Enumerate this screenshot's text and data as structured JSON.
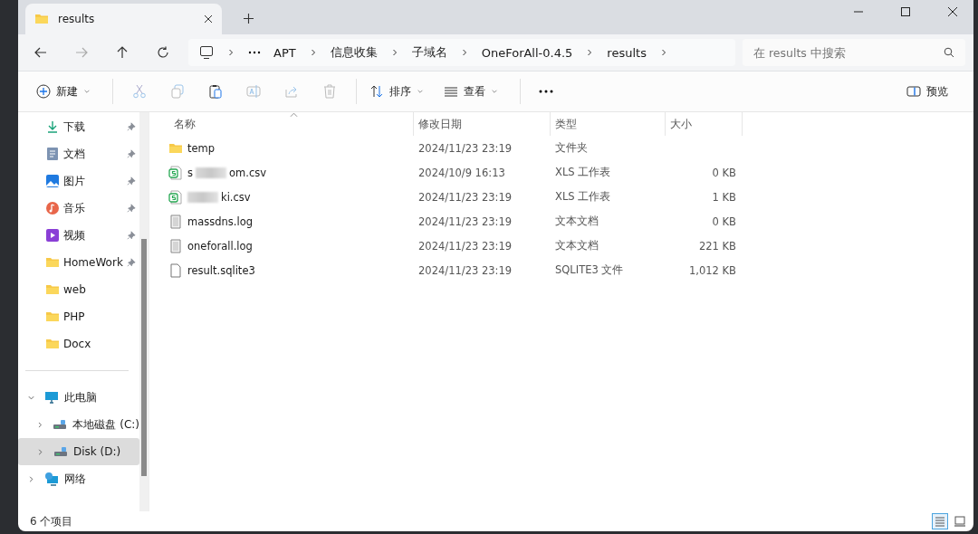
{
  "tab": {
    "title": "results",
    "selected": true
  },
  "breadcrumb": [
    "APT",
    "信息收集",
    "子域名",
    "OneForAll-0.4.5",
    "results"
  ],
  "search": {
    "placeholder": "在 results 中搜索"
  },
  "toolbar": {
    "new_label": "新建",
    "sort_label": "排序",
    "view_label": "查看",
    "preview_label": "预览"
  },
  "sidebar": {
    "items": [
      {
        "label": "下载",
        "kind": "download",
        "pinned": true,
        "selected": false
      },
      {
        "label": "文档",
        "kind": "document",
        "pinned": true,
        "selected": false
      },
      {
        "label": "图片",
        "kind": "pictures",
        "pinned": true,
        "selected": false
      },
      {
        "label": "音乐",
        "kind": "music",
        "pinned": true,
        "selected": false
      },
      {
        "label": "视频",
        "kind": "video",
        "pinned": true,
        "selected": false
      },
      {
        "label": "HomeWork",
        "kind": "folder",
        "pinned": true,
        "selected": false
      },
      {
        "label": "web",
        "kind": "folder",
        "pinned": false,
        "selected": false
      },
      {
        "label": "PHP",
        "kind": "folder",
        "pinned": false,
        "selected": false
      },
      {
        "label": "Docx",
        "kind": "folder",
        "pinned": false,
        "selected": false
      }
    ],
    "tree": [
      {
        "label": "此电脑",
        "kind": "computer",
        "expanded": true,
        "selected": false,
        "children": [
          {
            "label": "本地磁盘 (C:)",
            "kind": "drive",
            "expanded": false,
            "selected": false
          },
          {
            "label": "Disk (D:)",
            "kind": "drive",
            "expanded": false,
            "selected": true
          }
        ]
      },
      {
        "label": "网络",
        "kind": "network",
        "expanded": false,
        "selected": false
      }
    ]
  },
  "table": {
    "columns": [
      "名称",
      "修改日期",
      "类型",
      "大小"
    ],
    "rows": [
      {
        "name_start": "temp",
        "redacted": false,
        "name_end": "",
        "kind": "folder",
        "date": "2024/11/23 23:19",
        "type": "文件夹",
        "size": ""
      },
      {
        "name_start": "s",
        "redacted": true,
        "name_end": "om.csv",
        "kind": "sheet",
        "date": "2024/10/9 16:13",
        "type": "XLS 工作表",
        "size": "0 KB"
      },
      {
        "name_start": "",
        "redacted": true,
        "name_end": "ki.csv",
        "kind": "sheet",
        "date": "2024/11/23 23:19",
        "type": "XLS 工作表",
        "size": "1 KB"
      },
      {
        "name_start": "massdns.log",
        "redacted": false,
        "name_end": "",
        "kind": "text",
        "date": "2024/11/23 23:19",
        "type": "文本文档",
        "size": "0 KB"
      },
      {
        "name_start": "oneforall.log",
        "redacted": false,
        "name_end": "",
        "kind": "text",
        "date": "2024/11/23 23:19",
        "type": "文本文档",
        "size": "221 KB"
      },
      {
        "name_start": "result.sqlite3",
        "redacted": false,
        "name_end": "",
        "kind": "file",
        "date": "2024/11/23 23:19",
        "type": "SQLITE3 文件",
        "size": "1,012 KB"
      }
    ]
  },
  "status_bar": {
    "count": "6 个项目",
    "views": [
      {
        "kind": "details",
        "selected": true
      },
      {
        "kind": "tiles",
        "selected": false
      }
    ]
  }
}
